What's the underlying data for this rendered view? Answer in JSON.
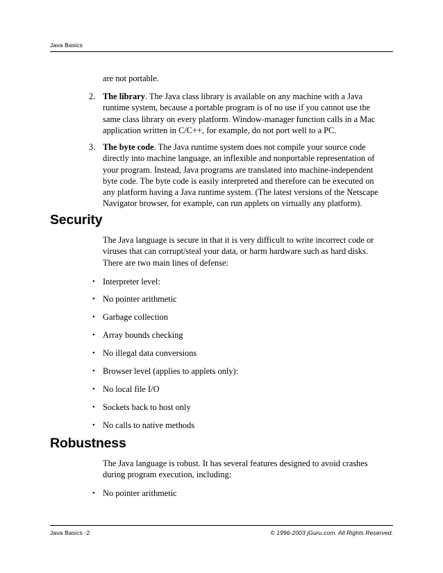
{
  "header": {
    "title": "Java Basics"
  },
  "footer": {
    "left": "Java Basics -2",
    "right": "© 1996-2003 jGuru.com. All Rights Reserved."
  },
  "content": {
    "continued_paragraph": "are not portable.",
    "numbered_items": [
      {
        "marker": "2.",
        "lead": "The library",
        "text": ". The Java class library is available on any machine with a Java runtime system, because a portable program is of no use if you cannot use the same class library on every platform. Window-manager function calls in a Mac application written in C/C++, for example, do not port well to a PC."
      },
      {
        "marker": "3.",
        "lead": "The byte code",
        "text": ". The Java runtime system does not compile your source code directly into machine language, an inflexible and nonportable representation of your program. Instead, Java programs are translated into machine-independent byte code. The byte code is easily interpreted and therefore can be executed on any platform having a Java runtime system. (The latest versions of the Netscape Navigator browser, for example, can run applets on virtually any platform)."
      }
    ],
    "sections": [
      {
        "heading": "Security",
        "paragraph": "The Java language is secure in that it is very difficult to write incorrect code or viruses that can corrupt/steal your data, or harm hardware such as hard disks. There are two main lines of defense:",
        "bullets": [
          "Interpreter level:",
          "No pointer arithmetic",
          "Garbage collection",
          "Array bounds checking",
          "No illegal data conversions",
          "Browser level (applies to applets only):",
          "No local file I/O",
          "Sockets back to host only",
          "No calls to native methods"
        ]
      },
      {
        "heading": "Robustness",
        "paragraph": "The Java language is robust. It has several features designed to avoid crashes during program execution, including:",
        "bullets": [
          "No pointer arithmetic"
        ]
      }
    ],
    "bullet_glyph": "•"
  }
}
